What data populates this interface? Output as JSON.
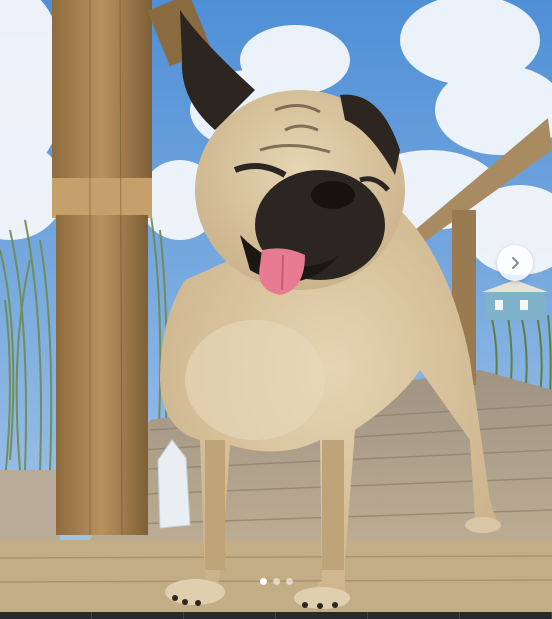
{
  "post": {
    "image_subject": "pug",
    "carousel": {
      "slide_count": 3,
      "active_index": 0
    },
    "next_button_icon": "chevron-right-icon"
  },
  "colors": {
    "sky": "#5f9fdc",
    "cloud": "#f4f7fb",
    "deck": "#a99a86",
    "post_wood": "#b08a55",
    "pug_fur": "#d8c4a0",
    "pug_mask": "#2b2622",
    "tongue": "#e77b92"
  }
}
